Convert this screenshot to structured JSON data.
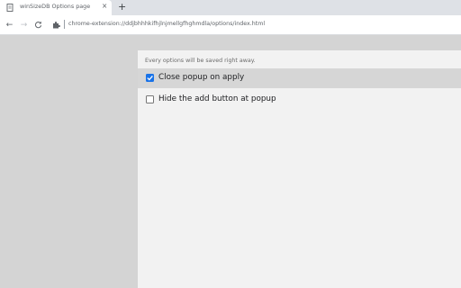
{
  "tab": {
    "title": "winSizeDB Options page",
    "close_glyph": "×",
    "new_tab_glyph": "+"
  },
  "toolbar": {
    "back_glyph": "←",
    "forward_glyph": "→",
    "reload_glyph": "C",
    "url_scheme": "chrome-extension://",
    "url": "chrome-extension://ddjbhhhkifhjlnjmellgfhghmdla/options/index.html"
  },
  "page": {
    "notice": "Every options will be saved right away.",
    "options": [
      {
        "label": "Close popup on apply",
        "checked": true
      },
      {
        "label": "Hide the add button at popup",
        "checked": false
      }
    ]
  },
  "icons": {
    "tab_favicon": "document-icon",
    "site_info": "puzzle-icon"
  },
  "colors": {
    "accent": "#1a73e8",
    "page_background": "#f2f2f2",
    "side_background": "#d4d4d4",
    "highlight_row": "#d6d6d6"
  }
}
